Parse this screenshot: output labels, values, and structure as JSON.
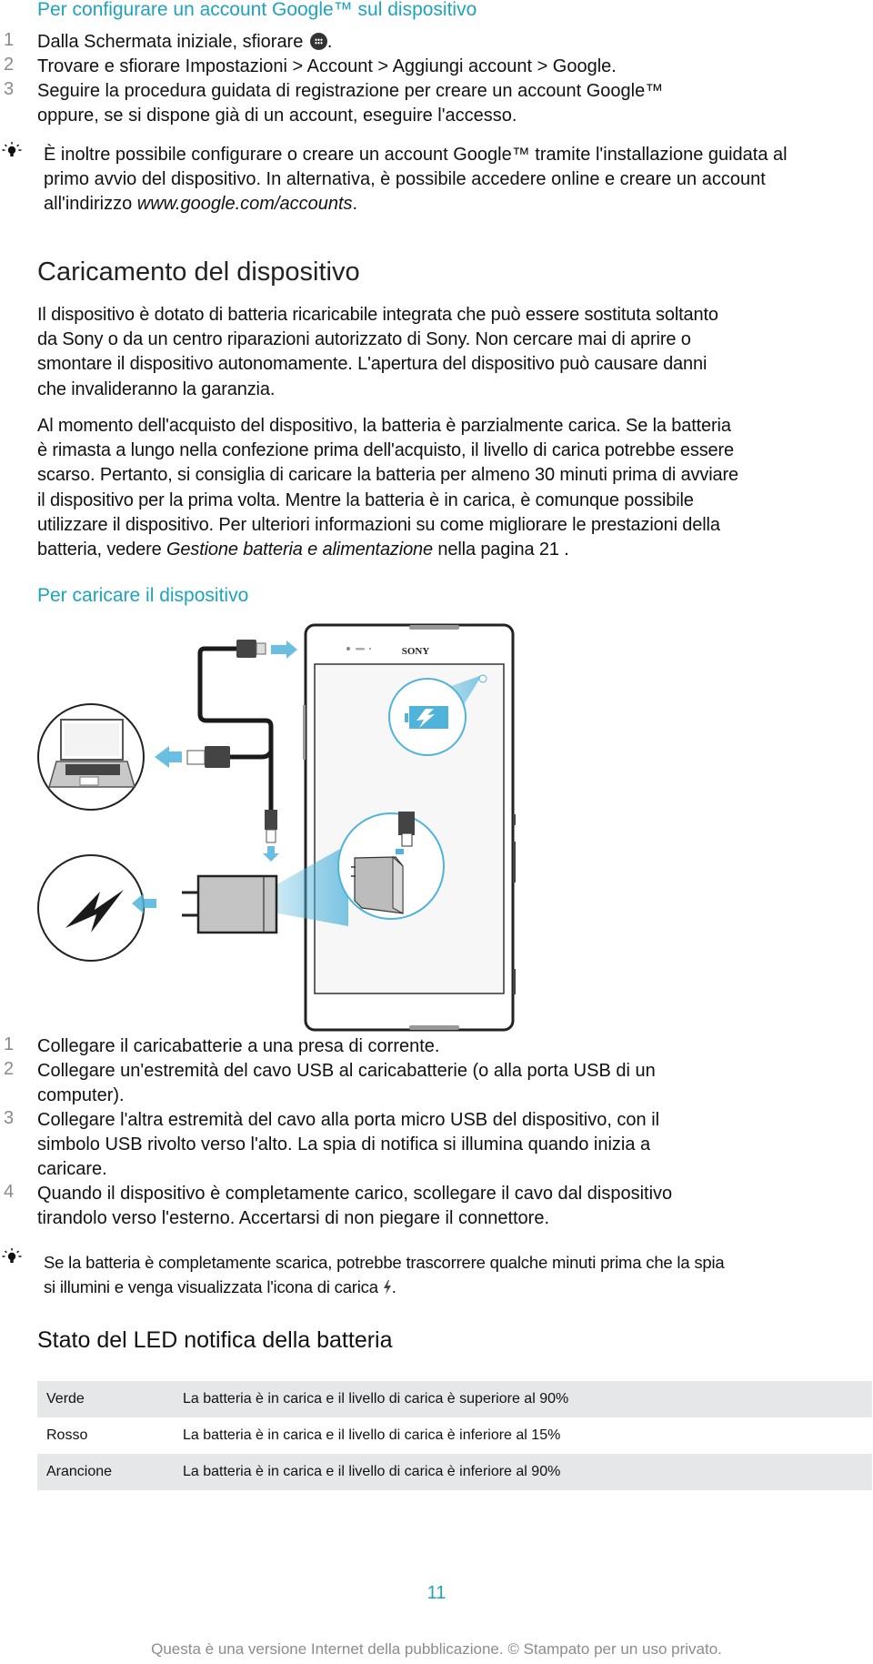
{
  "section_google": {
    "title": "Per configurare un account Google™ sul dispositivo",
    "steps": [
      {
        "num": "1",
        "text_before": "Dalla Schermata iniziale, sfiorare ",
        "icon": "apps-icon",
        "text_after": "."
      },
      {
        "num": "2",
        "text": "Trovare e sfiorare Impostazioni > Account > Aggiungi account > Google."
      },
      {
        "num": "3",
        "lines": [
          "Seguire la procedura guidata di registrazione per creare un account Google™",
          "oppure, se si dispone già di un account, eseguire l'accesso."
        ]
      }
    ],
    "tip": {
      "icon": "lightbulb-icon",
      "lines": [
        "È inoltre possibile configurare o creare un account Google™ tramite l'installazione guidata al",
        "primo avvio del dispositivo. In alternativa, è possibile accedere online e creare un account"
      ],
      "line3_prefix": "all'indirizzo ",
      "link": "www.google.com/accounts",
      "line3_suffix": "."
    }
  },
  "section_charging": {
    "heading": "Caricamento del dispositivo",
    "para1": [
      "Il dispositivo è dotato di batteria ricaricabile integrata che può essere sostituta soltanto",
      "da Sony o da un centro riparazioni autorizzato di Sony. Non cercare mai di aprire o",
      "smontare il dispositivo autonomamente. L'apertura del dispositivo può causare danni",
      "che invalideranno la garanzia."
    ],
    "para2": [
      "Al momento dell'acquisto del dispositivo, la batteria è parzialmente carica. Se la batteria",
      "è rimasta a lungo nella confezione prima dell'acquisto, il livello di carica potrebbe essere",
      "scarso. Pertanto, si consiglia di caricare la batteria per almeno 30 minuti prima di avviare",
      "il dispositivo per la prima volta. Mentre la batteria è in carica, è comunque possibile",
      "utilizzare il dispositivo. Per ulteriori informazioni su come migliorare le prestazioni della"
    ],
    "para2_last_prefix": "batteria, vedere ",
    "para2_link": "Gestione batteria e alimentazione",
    "para2_last_suffix": " nella pagina 21 ."
  },
  "section_howto": {
    "title": "Per caricare il dispositivo",
    "illustration": {
      "brand": "SONY",
      "alt": "Charging illustration: USB cable connecting phone to laptop or wall charger"
    },
    "steps": [
      {
        "num": "1",
        "lines": [
          "Collegare il caricabatterie a una presa di corrente."
        ]
      },
      {
        "num": "2",
        "lines": [
          "Collegare un'estremità del cavo USB al caricabatterie (o alla porta USB di un",
          "computer)."
        ]
      },
      {
        "num": "3",
        "lines": [
          "Collegare l'altra estremità del cavo alla porta micro USB del dispositivo, con il",
          "simbolo USB rivolto verso l'alto. La spia di notifica si illumina quando inizia a",
          "caricare."
        ]
      },
      {
        "num": "4",
        "lines": [
          "Quando il dispositivo è completamente carico, scollegare il cavo dal dispositivo",
          "tirandolo verso l'esterno. Accertarsi di non piegare il connettore."
        ]
      }
    ],
    "tip": {
      "icon": "lightbulb-icon",
      "line1": "Se la batteria è completamente scarica, potrebbe trascorrere qualche minuti prima che la spia",
      "line2_prefix": "si illumini e venga visualizzata l'icona di carica ",
      "line2_icon": "charging-bolt-icon",
      "line2_suffix": "."
    }
  },
  "section_led": {
    "heading": "Stato del LED notifica della batteria",
    "rows": [
      {
        "color": "Verde",
        "description": "La batteria è in carica e il livello di carica è superiore al 90%"
      },
      {
        "color": "Rosso",
        "description": "La batteria è in carica e il livello di carica è inferiore al 15%"
      },
      {
        "color": "Arancione",
        "description": "La batteria è in carica e il livello di carica è inferiore al 90%"
      }
    ]
  },
  "page_number": "11",
  "footer": "Questa è una versione Internet della pubblicazione. © Stampato per un uso privato.",
  "colors": {
    "accent": "#1ea3bd",
    "illustration_blue": "#4fb3dc",
    "table_stripe": "#e6e7e8"
  }
}
